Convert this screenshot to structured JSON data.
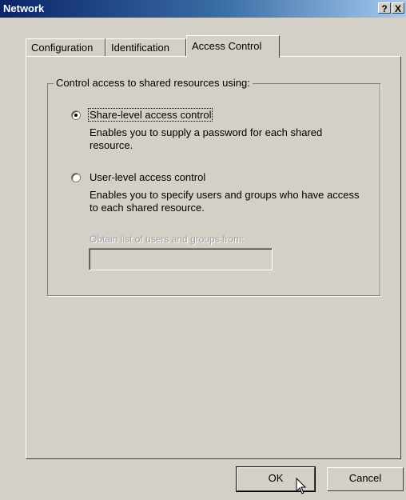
{
  "window": {
    "title": "Network",
    "help_glyph": "?",
    "close_glyph": "X"
  },
  "tabs": [
    {
      "label": "Configuration",
      "active": false
    },
    {
      "label": "Identification",
      "active": false
    },
    {
      "label": "Access Control",
      "active": true
    }
  ],
  "access_control": {
    "group_label": "Control access to shared resources using:",
    "share_level": {
      "label": "Share-level access control",
      "selected": true,
      "description": "Enables you to supply a password for each shared resource."
    },
    "user_level": {
      "label": "User-level access control",
      "selected": false,
      "description": "Enables you to specify users and groups who have access to each shared resource."
    },
    "obtain_list_label": "Obtain list of users and groups from:",
    "obtain_list_value": ""
  },
  "buttons": {
    "ok": "OK",
    "cancel": "Cancel"
  },
  "icons": [
    "help-icon",
    "close-icon",
    "radio-selected",
    "radio-unselected",
    "mouse-cursor-icon"
  ]
}
